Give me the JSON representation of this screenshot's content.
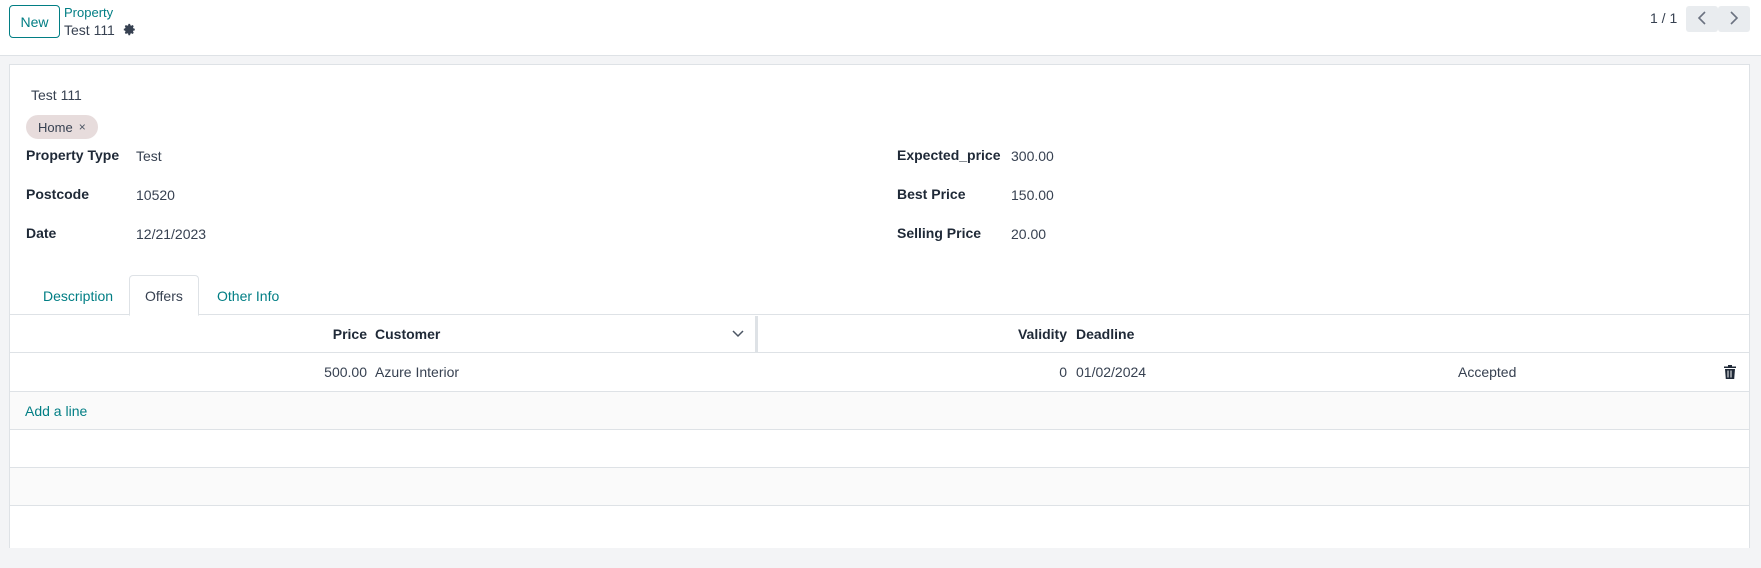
{
  "header": {
    "new_button": "New",
    "breadcrumb_parent": "Property",
    "breadcrumb_current": "Test 111",
    "pager_value": "1 / 1"
  },
  "record": {
    "name": "Test 111",
    "tags": [
      {
        "label": "Home",
        "remove": "×"
      }
    ]
  },
  "fields_left": [
    {
      "label": "Property Type",
      "value": "Test"
    },
    {
      "label": "Postcode",
      "value": "10520"
    },
    {
      "label": "Date",
      "value": "12/21/2023"
    }
  ],
  "fields_right": [
    {
      "label": "Expected_price",
      "value": "300.00"
    },
    {
      "label": "Best Price",
      "value": "150.00"
    },
    {
      "label": "Selling Price",
      "value": "20.00"
    }
  ],
  "tabs": [
    {
      "label": "Description",
      "active": false
    },
    {
      "label": "Offers",
      "active": true
    },
    {
      "label": "Other Info",
      "active": false
    }
  ],
  "offers_table": {
    "headers": {
      "price": "Price",
      "customer": "Customer",
      "validity": "Validity",
      "deadline": "Deadline"
    },
    "rows": [
      {
        "price": "500.00",
        "customer": "Azure Interior",
        "validity": "0",
        "deadline": "01/02/2024",
        "status": "Accepted"
      }
    ],
    "add_line": "Add a line"
  },
  "icons": {
    "gear": "gear-icon",
    "prev": "chevron-left-icon",
    "next": "chevron-right-icon",
    "sort": "chevron-down-icon",
    "delete": "trash-icon"
  },
  "colors": {
    "accent": "#017e84",
    "tag_bg": "#e7dcdc"
  }
}
